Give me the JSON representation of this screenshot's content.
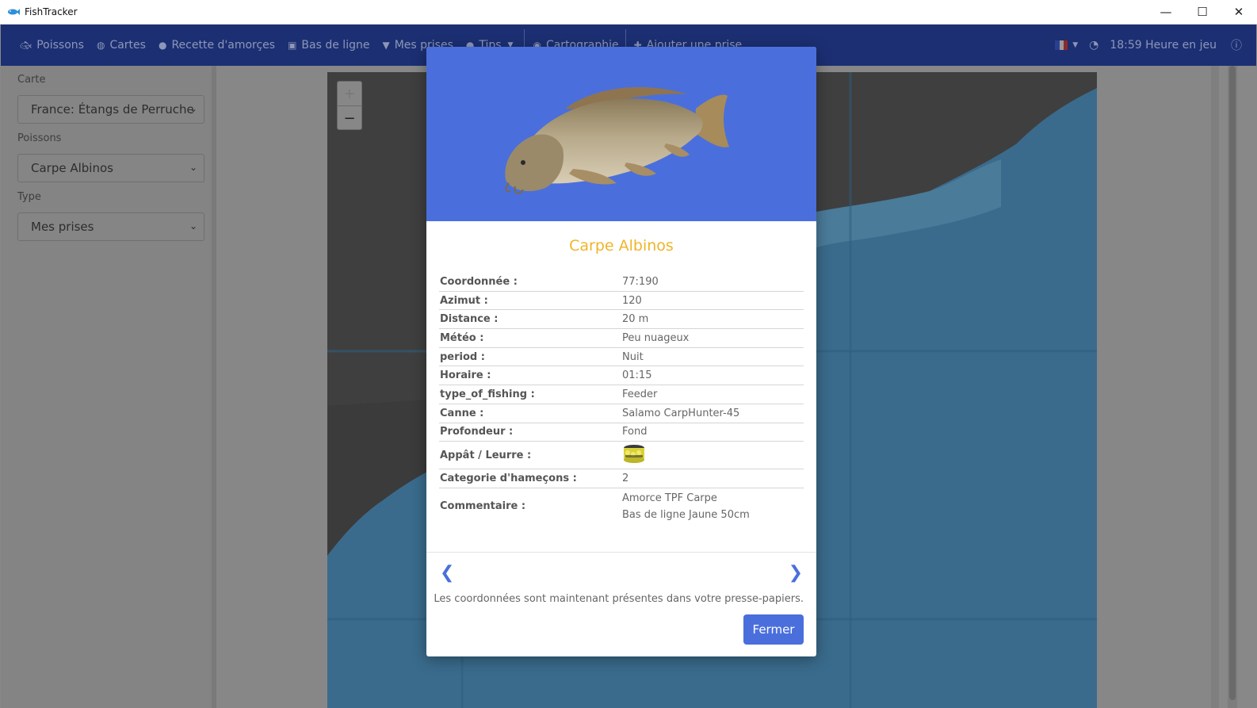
{
  "window": {
    "title": "FishTracker",
    "controls": {
      "minimize": "—",
      "maximize": "☐",
      "close": "✕"
    }
  },
  "nav": {
    "items": [
      {
        "label": "Poissons",
        "icon": "fish-icon"
      },
      {
        "label": "Cartes",
        "icon": "globe-icon"
      },
      {
        "label": "Recette d'amorçes",
        "icon": "recipe-icon"
      },
      {
        "label": "Bas de ligne",
        "icon": "tackle-icon"
      },
      {
        "label": "Mes prises",
        "icon": "trophy-icon"
      },
      {
        "label": "Tips",
        "icon": "lightbulb-icon"
      },
      {
        "label": "Cartographie",
        "icon": "compass-icon"
      },
      {
        "label": "Ajouter une prise",
        "icon": "plus-icon"
      }
    ],
    "game_time": "18:59 Heure en jeu",
    "language": "fr"
  },
  "sidebar": {
    "carte_label": "Carte",
    "carte_value": "France: Étangs de Perruche",
    "poissons_label": "Poissons",
    "poissons_value": "Carpe Albinos",
    "type_label": "Type",
    "type_value": "Mes prises"
  },
  "map": {
    "zoom_in": "+",
    "zoom_out": "−"
  },
  "modal": {
    "header_color": "#4a6fdc",
    "title": "Carpe Albinos",
    "rows": [
      {
        "key": "Coordonnée :",
        "value": "77:190"
      },
      {
        "key": "Azimut :",
        "value": "120"
      },
      {
        "key": "Distance :",
        "value": "20 m"
      },
      {
        "key": "Météo :",
        "value": "Peu nuageux"
      },
      {
        "key": "period :",
        "value": "Nuit"
      },
      {
        "key": "Horaire :",
        "value": "01:15"
      },
      {
        "key": "type_of_fishing :",
        "value": "Feeder"
      },
      {
        "key": "Canne :",
        "value": "Salamo CarpHunter-45"
      },
      {
        "key": "Profondeur :",
        "value": "Fond"
      },
      {
        "key": "Appât / Leurre :",
        "value": ""
      },
      {
        "key": "Categorie d'hameçons :",
        "value": "2"
      },
      {
        "key": "Commentaire :",
        "value_line1": "Amorce TPF Carpe",
        "value_line2": "Bas de ligne Jaune 50cm"
      }
    ],
    "prev_arrow": "❮",
    "next_arrow": "❯",
    "clipboard_message": "Les coordonnées sont maintenant présentes dans votre presse-papiers.",
    "close_label": "Fermer"
  }
}
